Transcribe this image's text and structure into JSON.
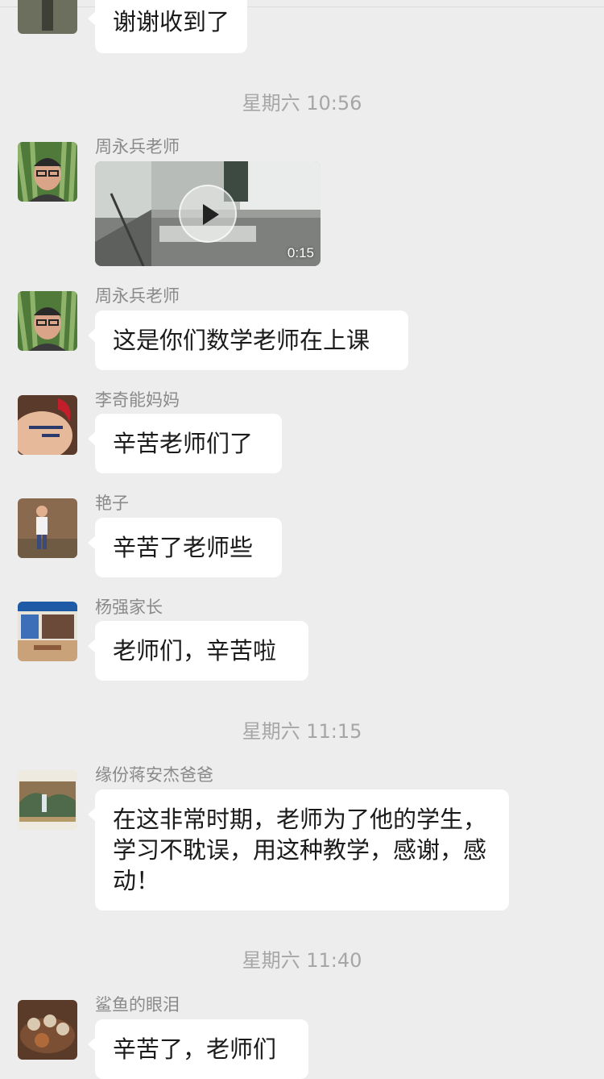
{
  "messages": {
    "m0": {
      "text": "谢谢收到了"
    },
    "ts1": "星期六 10:56",
    "m1": {
      "sender": "周永兵老师",
      "video_duration": "0:15",
      "avatar_icon": "teacher-avatar-icon"
    },
    "m2": {
      "sender": "周永兵老师",
      "text": "这是你们数学老师在上课"
    },
    "m3": {
      "sender": "李奇能妈妈",
      "text": "辛苦老师们了",
      "avatar_icon": "tattoo-avatar-icon"
    },
    "m4": {
      "sender": "艳子",
      "text": "辛苦了老师些",
      "avatar_icon": "child-avatar-icon"
    },
    "m5": {
      "sender": "杨强家长",
      "text": "老师们，辛苦啦",
      "avatar_icon": "storefront-avatar-icon"
    },
    "ts2": "星期六 11:15",
    "m6": {
      "sender": "缘份蒋安杰爸爸",
      "text": "在这非常时期，老师为了他的学生，学习不耽误，用这种教学，感谢，感动！",
      "avatar_icon": "landscape-avatar-icon"
    },
    "ts3": "星期六 11:40",
    "m7": {
      "sender": "鲨鱼的眼泪",
      "text": "辛苦了，老师们",
      "avatar_icon": "tea-set-avatar-icon"
    }
  },
  "colors": {
    "background": "#ededed",
    "bubble": "#ffffff",
    "timestamp_text": "#a6a6a6",
    "sender_text": "#8a8a8a"
  }
}
